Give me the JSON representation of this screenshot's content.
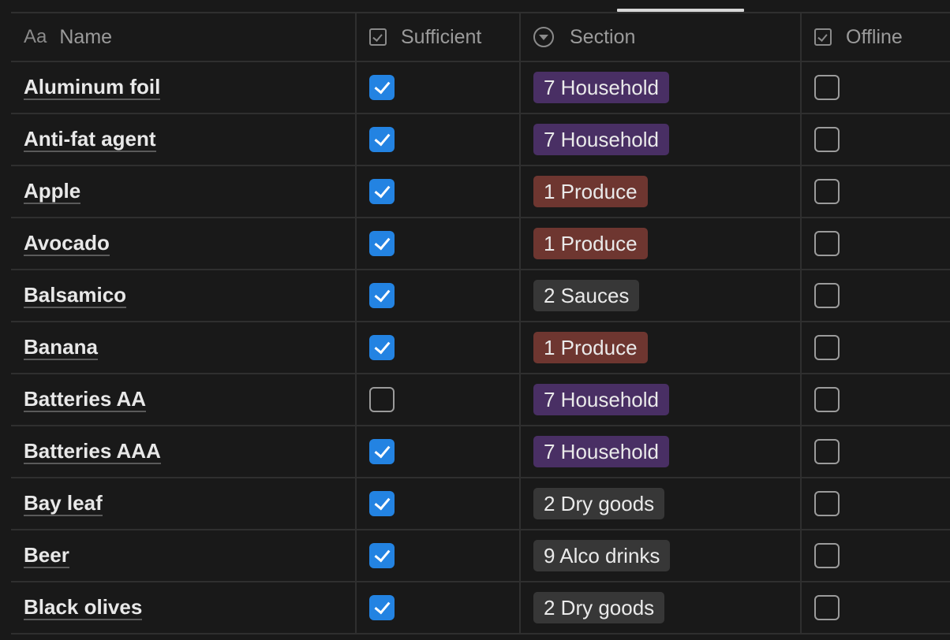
{
  "header": {
    "name_icon": "Aa",
    "name_label": "Name",
    "sufficient_label": "Sufficient",
    "section_label": "Section",
    "offline_label": "Offline"
  },
  "colors": {
    "household": "#492f64",
    "produce": "#6e3630",
    "neutral": "#373737",
    "checkbox_on": "#2383e2"
  },
  "rows": [
    {
      "name": "Aluminum foil",
      "sufficient": true,
      "section": "7 Household",
      "section_color": "#492f64",
      "offline": false
    },
    {
      "name": "Anti-fat agent",
      "sufficient": true,
      "section": "7 Household",
      "section_color": "#492f64",
      "offline": false
    },
    {
      "name": "Apple",
      "sufficient": true,
      "section": "1 Produce",
      "section_color": "#6e3630",
      "offline": false
    },
    {
      "name": "Avocado",
      "sufficient": true,
      "section": "1 Produce",
      "section_color": "#6e3630",
      "offline": false
    },
    {
      "name": "Balsamico",
      "sufficient": true,
      "section": "2 Sauces",
      "section_color": "#373737",
      "offline": false
    },
    {
      "name": "Banana",
      "sufficient": true,
      "section": "1 Produce",
      "section_color": "#6e3630",
      "offline": false
    },
    {
      "name": "Batteries AA",
      "sufficient": false,
      "section": "7 Household",
      "section_color": "#492f64",
      "offline": false
    },
    {
      "name": "Batteries AAA",
      "sufficient": true,
      "section": "7 Household",
      "section_color": "#492f64",
      "offline": false
    },
    {
      "name": "Bay leaf",
      "sufficient": true,
      "section": "2 Dry goods",
      "section_color": "#373737",
      "offline": false
    },
    {
      "name": "Beer",
      "sufficient": true,
      "section": "9 Alco drinks",
      "section_color": "#373737",
      "offline": false
    },
    {
      "name": "Black olives",
      "sufficient": true,
      "section": "2 Dry goods",
      "section_color": "#373737",
      "offline": false
    }
  ]
}
